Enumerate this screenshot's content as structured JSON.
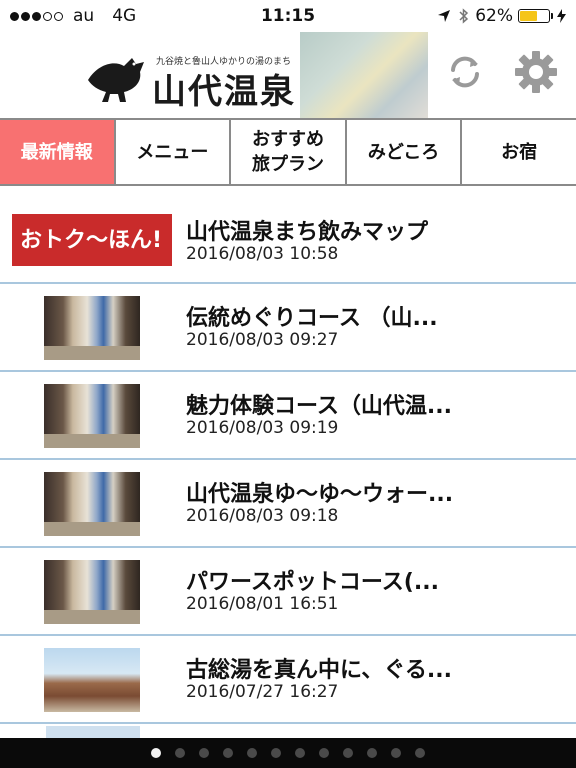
{
  "status_bar": {
    "carrier": "au",
    "network": "4G",
    "time": "11:15",
    "battery_pct": "62%",
    "battery_level": 0.62,
    "icons": [
      "location-arrow-icon",
      "bluetooth-icon",
      "battery-icon",
      "charging-bolt-icon"
    ]
  },
  "header": {
    "logo_text": "山代温泉",
    "logo_tagline": "九谷焼と魯山人ゆかりの湯のまち",
    "refresh_icon": "refresh-icon",
    "settings_icon": "gear-icon"
  },
  "tabs": [
    {
      "label": "最新情報",
      "active": true
    },
    {
      "label": "メニュー",
      "active": false
    },
    {
      "label": "おすすめ\n旅プラン",
      "active": false
    },
    {
      "label": "みどころ",
      "active": false
    },
    {
      "label": "お宿",
      "active": false
    }
  ],
  "banner_thumb": {
    "text": "おトク〜ほん!"
  },
  "items": [
    {
      "title": "山代温泉まち飲みマップ",
      "date": "2016/08/03 10:58"
    },
    {
      "title": "伝統めぐりコース （山...",
      "date": "2016/08/03 09:27"
    },
    {
      "title": "魅力体験コース（山代温...",
      "date": "2016/08/03 09:19"
    },
    {
      "title": "山代温泉ゆ〜ゆ〜ウォー...",
      "date": "2016/08/03 09:18"
    },
    {
      "title": "パワースポットコース(...",
      "date": "2016/08/01 16:51"
    },
    {
      "title": "古総湯を真ん中に、ぐる...",
      "date": "2016/07/27 16:27"
    }
  ],
  "pager": {
    "count": 12,
    "active_index": 0
  },
  "colors": {
    "active_tab": "#f87171",
    "divider": "#a9c7de",
    "battery": "#f5c518"
  }
}
